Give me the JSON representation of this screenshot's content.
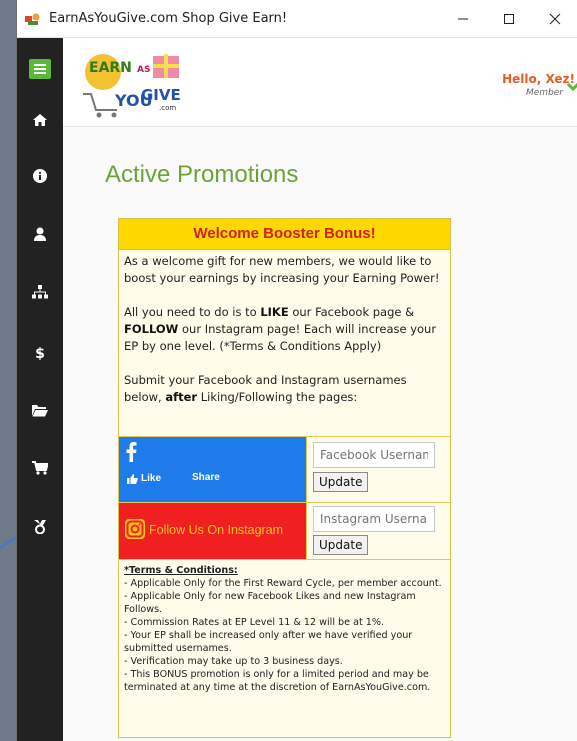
{
  "window": {
    "title": "EarnAsYouGive.com Shop Give Earn!"
  },
  "header": {
    "greeting": "Hello, Xez!",
    "role": "Member"
  },
  "sidebar": {
    "items": [
      {
        "icon": "menu-icon",
        "active": true
      },
      {
        "icon": "home-icon"
      },
      {
        "icon": "info-icon"
      },
      {
        "icon": "user-icon"
      },
      {
        "icon": "sitemap-icon"
      },
      {
        "icon": "dollar-icon"
      },
      {
        "icon": "folder-icon"
      },
      {
        "icon": "cart-icon"
      },
      {
        "icon": "ribbon-icon"
      }
    ],
    "active_color": "#5cb83a"
  },
  "logo": {
    "line1": "EARN",
    "line2": "AS",
    "line3": "YOU",
    "line4": "GIVE",
    "domain": ".com"
  },
  "main": {
    "title": "Active Promotions"
  },
  "promo": {
    "title": "Welcome Booster Bonus!",
    "p1": "As a welcome gift for new members, we would like to boost your earnings by increasing your Earning Power!",
    "p2_a": "All you need to do is to ",
    "p2_like": "LIKE",
    "p2_b": " our Facebook page & ",
    "p2_follow": "FOLLOW",
    "p2_c": " our Instagram page! Each will increase your EP by one level. (*Terms & Conditions Apply)",
    "p3_a": "Submit your Facebook and Instagram usernames below, ",
    "p3_after": "after",
    "p3_b": " Liking/Following the pages:"
  },
  "facebook": {
    "like_label": "Like",
    "share_label": "Share",
    "placeholder": "Facebook Username",
    "update_label": "Update"
  },
  "instagram": {
    "follow_label": "Follow Us On Instagram",
    "placeholder": "Instagram Username",
    "update_label": "Update"
  },
  "terms": {
    "title": "*Terms & Conditions:",
    "items": [
      "- Applicable Only for the First Reward Cycle, per member account.",
      "- Applicable Only for new Facebook Likes and new Instagram Follows.",
      "- Commission Rates at EP Level 11 & 12 will be at 1%.",
      "- Your EP shall be increased only after we have verified your submitted usernames.",
      "- Verification may take up to 3 business days.",
      "- This BONUS promotion is only for a limited period and may be terminated at any time at the discretion of EarnAsYouGive.com."
    ]
  }
}
